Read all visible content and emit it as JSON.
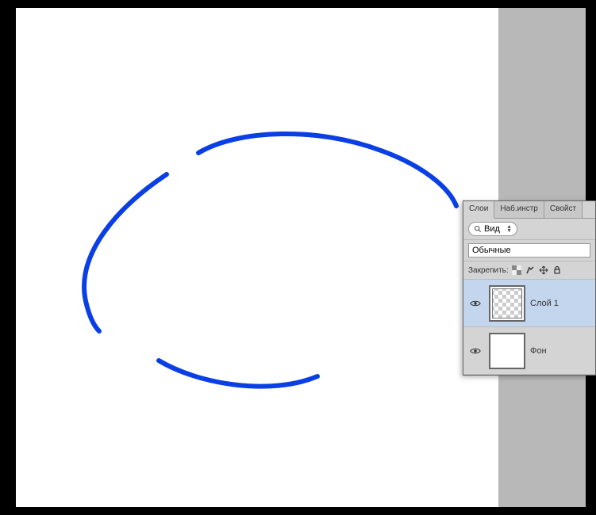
{
  "panel": {
    "tabs": [
      {
        "label": "Слои",
        "active": true
      },
      {
        "label": "Наб.инстр",
        "active": false
      },
      {
        "label": "Свойст",
        "active": false
      }
    ],
    "filter": {
      "label": "Вид"
    },
    "blend_mode": "Обычные",
    "lock_label": "Закрепить:",
    "layers": [
      {
        "name": "Слой 1",
        "visible": true,
        "selected": true,
        "thumb": "checker"
      },
      {
        "name": "Фон",
        "visible": true,
        "selected": false,
        "thumb": "white"
      }
    ]
  }
}
